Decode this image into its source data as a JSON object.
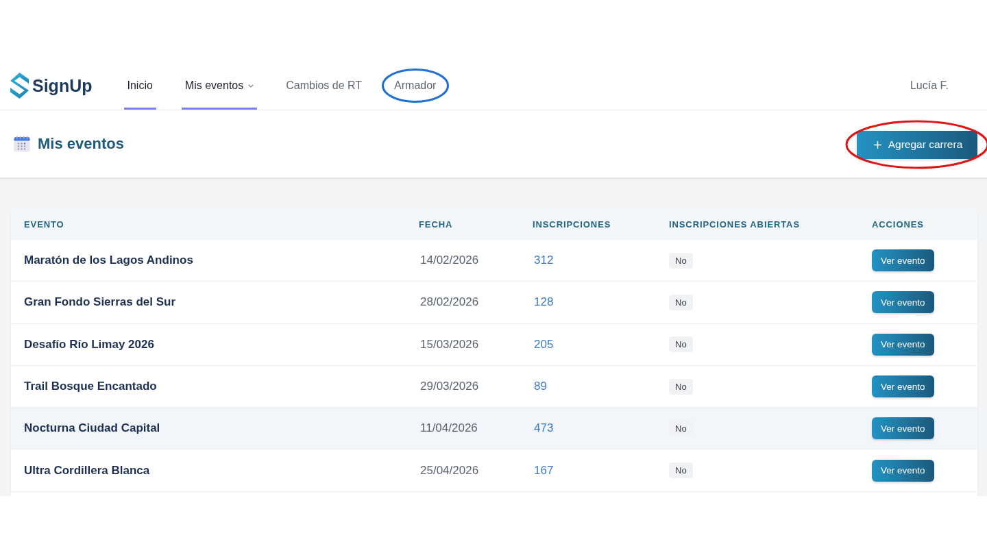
{
  "brand": {
    "name": "SignUp"
  },
  "nav": {
    "items": [
      {
        "label": "Inicio",
        "selected": true,
        "has_menu": false,
        "circled": false
      },
      {
        "label": "Mis eventos",
        "selected": true,
        "has_menu": true,
        "circled": false
      },
      {
        "label": "Cambios de RT",
        "selected": false,
        "has_menu": false,
        "circled": false
      },
      {
        "label": "Armador",
        "selected": false,
        "has_menu": false,
        "circled": true
      }
    ],
    "user": "Lucía F."
  },
  "header": {
    "title": "Mis eventos",
    "add_button": {
      "label": "Agregar carrera",
      "circled": true
    }
  },
  "table": {
    "columns": [
      "EVENTO",
      "FECHA",
      "INSCRIPCIONES",
      "INSCRIPCIONES ABIERTAS",
      "ACCIONES"
    ],
    "rows": [
      {
        "event": "Maratón de los Lagos Andinos",
        "date": "14/02/2026",
        "registrations": "312",
        "open": "No",
        "action": "Ver evento",
        "highlighted": false
      },
      {
        "event": "Gran Fondo Sierras del Sur",
        "date": "28/02/2026",
        "registrations": "128",
        "open": "No",
        "action": "Ver evento",
        "highlighted": false
      },
      {
        "event": "Desafío Río Limay 2026",
        "date": "15/03/2026",
        "registrations": "205",
        "open": "No",
        "action": "Ver evento",
        "highlighted": false
      },
      {
        "event": "Trail Bosque Encantado",
        "date": "29/03/2026",
        "registrations": "89",
        "open": "No",
        "action": "Ver evento",
        "highlighted": false
      },
      {
        "event": "Nocturna Ciudad Capital",
        "date": "11/04/2026",
        "registrations": "473",
        "open": "No",
        "action": "Ver evento",
        "highlighted": true
      },
      {
        "event": "Ultra Cordillera Blanca",
        "date": "25/04/2026",
        "registrations": "167",
        "open": "No",
        "action": "Ver evento",
        "highlighted": false
      }
    ]
  }
}
